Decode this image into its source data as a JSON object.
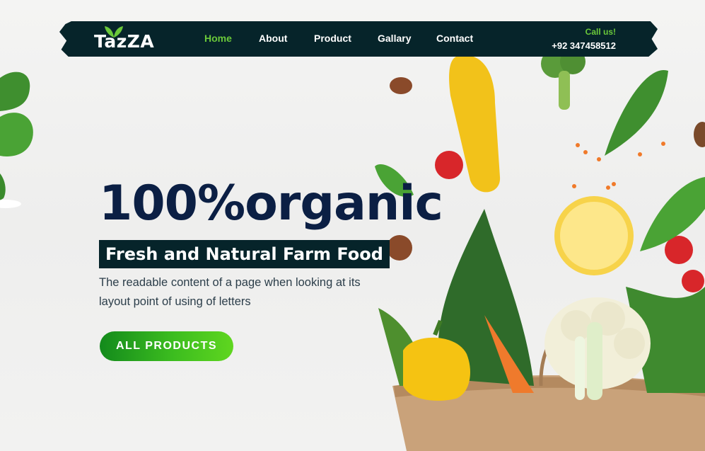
{
  "brand": {
    "name": "TazZA"
  },
  "nav": {
    "items": [
      {
        "label": "Home",
        "active": true
      },
      {
        "label": "About",
        "active": false
      },
      {
        "label": "Product",
        "active": false
      },
      {
        "label": "Gallary",
        "active": false
      },
      {
        "label": "Contact",
        "active": false
      }
    ],
    "call_label": "Call us!",
    "phone": "+92 347458512"
  },
  "hero": {
    "headline": "100%organic",
    "subheadline": "Fresh and Natural Farm Food",
    "description": "The readable content of a page when looking at its layout point of using of letters",
    "cta_label": "ALL PRODUCTS"
  },
  "colors": {
    "nav_bg": "#06242a",
    "accent_green": "#6bc93a",
    "headline": "#0b1f44",
    "cta_start": "#138a1c",
    "cta_end": "#5fd61f"
  },
  "icons": [
    "leaf-logo-icon"
  ]
}
